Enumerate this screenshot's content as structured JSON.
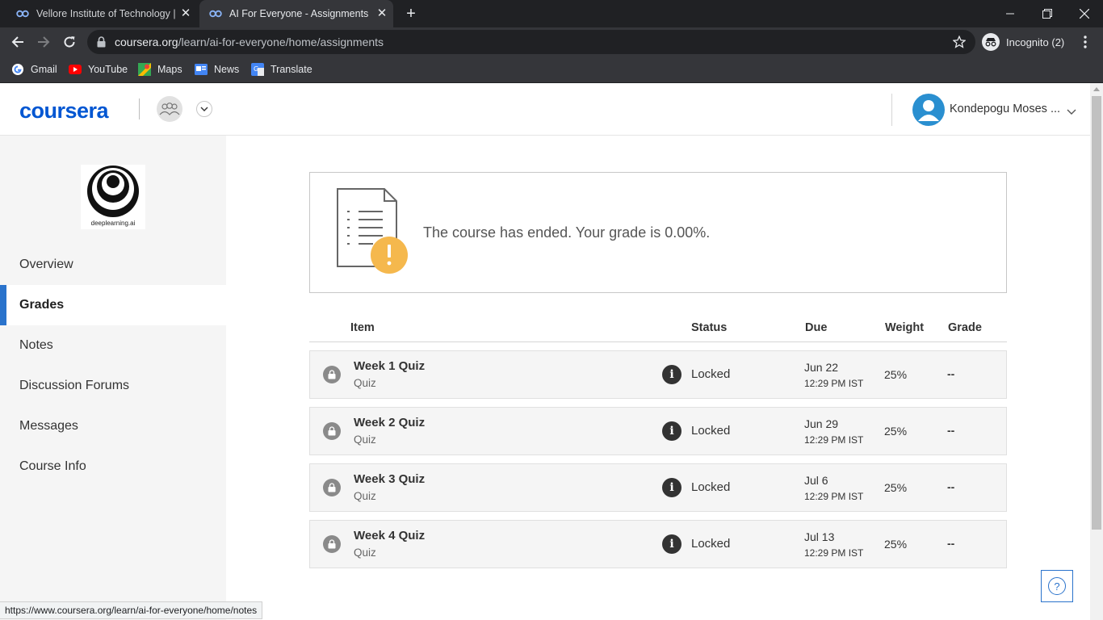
{
  "browser": {
    "tabs": [
      {
        "title": "Vellore Institute of Technology | C"
      },
      {
        "title": "AI For Everyone - Assignments | C"
      }
    ],
    "url_host": "coursera.org",
    "url_path": "/learn/ai-for-everyone/home/assignments",
    "incognito_label": "Incognito (2)",
    "bookmarks": [
      {
        "label": "Gmail"
      },
      {
        "label": "YouTube"
      },
      {
        "label": "Maps"
      },
      {
        "label": "News"
      },
      {
        "label": "Translate"
      }
    ],
    "status_url": "https://www.coursera.org/learn/ai-for-everyone/home/notes"
  },
  "header": {
    "logo": "coursera",
    "user_name": "Kondepogu Moses ..."
  },
  "sidebar": {
    "partner_label": "deeplearning.ai",
    "items": [
      {
        "label": "Overview"
      },
      {
        "label": "Grades"
      },
      {
        "label": "Notes"
      },
      {
        "label": "Discussion Forums"
      },
      {
        "label": "Messages"
      },
      {
        "label": "Course Info"
      }
    ],
    "active_index": 1
  },
  "banner": {
    "message": "The course has ended. Your grade is 0.00%."
  },
  "table": {
    "headers": {
      "item": "Item",
      "status": "Status",
      "due": "Due",
      "weight": "Weight",
      "grade": "Grade"
    },
    "rows": [
      {
        "name": "Week 1 Quiz",
        "type": "Quiz",
        "status": "Locked",
        "due_date": "Jun 22",
        "due_time": "12:29 PM IST",
        "weight": "25%",
        "grade": "--"
      },
      {
        "name": "Week 2 Quiz",
        "type": "Quiz",
        "status": "Locked",
        "due_date": "Jun 29",
        "due_time": "12:29 PM IST",
        "weight": "25%",
        "grade": "--"
      },
      {
        "name": "Week 3 Quiz",
        "type": "Quiz",
        "status": "Locked",
        "due_date": "Jul 6",
        "due_time": "12:29 PM IST",
        "weight": "25%",
        "grade": "--"
      },
      {
        "name": "Week 4 Quiz",
        "type": "Quiz",
        "status": "Locked",
        "due_date": "Jul 13",
        "due_time": "12:29 PM IST",
        "weight": "25%",
        "grade": "--"
      }
    ]
  },
  "help": {
    "label": "?"
  },
  "colors": {
    "brand": "#0056d2",
    "active_bar": "#2a73cc",
    "warning": "#f5b84d",
    "avatar": "#2a8fd0"
  }
}
